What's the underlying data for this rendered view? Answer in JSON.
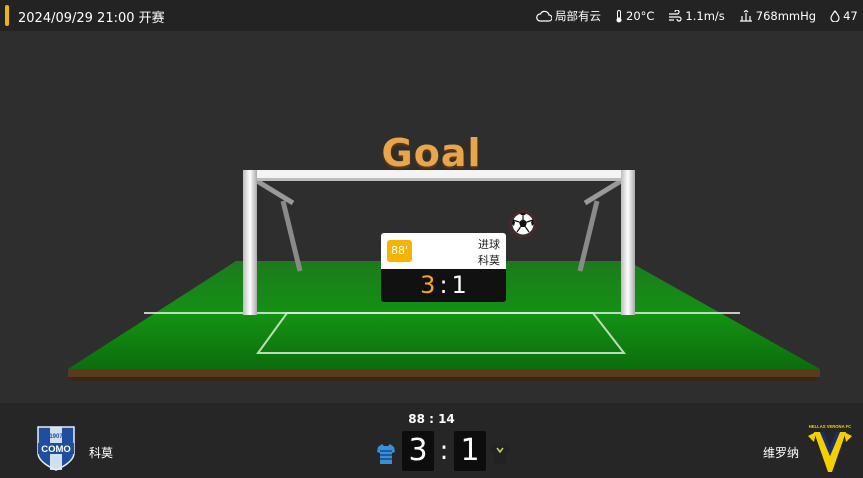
{
  "header": {
    "kickoff": "2024/09/29 21:00 开赛",
    "accent_color": "#f5b400",
    "weather": {
      "condition": "局部有云",
      "condition_icon": "cloud-icon",
      "temperature": "20°C",
      "temperature_icon": "thermometer-icon",
      "wind": "1.1m/s",
      "wind_icon": "wind-icon",
      "pressure": "768mmHg",
      "pressure_icon": "pressure-icon",
      "humidity": "47",
      "humidity_icon": "droplet-icon"
    }
  },
  "animation": {
    "title": "Goal",
    "event": {
      "minute": "88'",
      "type": "进球",
      "team": "科莫",
      "home_score": "3",
      "separator": ":",
      "away_score": "1"
    }
  },
  "match": {
    "clock": "88 : 14",
    "home": {
      "name": "科莫",
      "logo_text": "COMO",
      "logo_year": "1907",
      "score": "3",
      "kit_color": "#3a8fd8"
    },
    "away": {
      "name": "维罗纳",
      "logo_text": "HELLAS VERONA FC",
      "score": "1",
      "kit_color": "#f5d000"
    },
    "score_separator": ":"
  }
}
